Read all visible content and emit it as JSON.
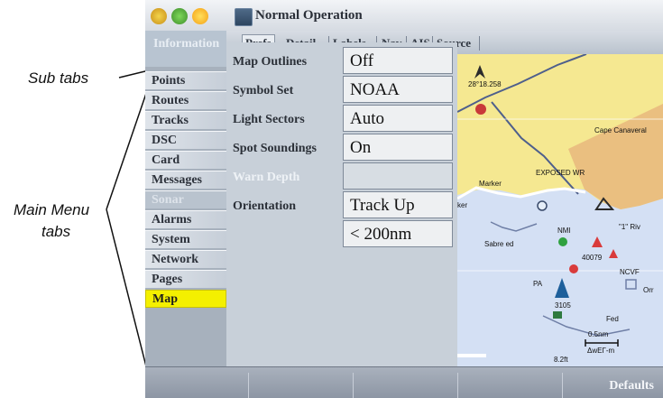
{
  "callouts": {
    "sub_tabs": "Sub tabs",
    "main_menu_tabs_line1": "Main Menu",
    "main_menu_tabs_line2": "tabs"
  },
  "window": {
    "title": "Normal Operation",
    "status_icons": [
      "battery-icon",
      "gps-icon",
      "sun-icon"
    ]
  },
  "sub_tabs": [
    {
      "label": "Prefs",
      "active": true
    },
    {
      "label": "Detail",
      "active": false
    },
    {
      "label": "Labels",
      "active": false
    },
    {
      "label": "Nav",
      "active": false
    },
    {
      "label": "AIS",
      "active": false
    },
    {
      "label": "Source",
      "active": false
    }
  ],
  "main_menu": {
    "header": "Information",
    "items": [
      {
        "label": "Points",
        "state": "normal"
      },
      {
        "label": "Routes",
        "state": "normal"
      },
      {
        "label": "Tracks",
        "state": "normal"
      },
      {
        "label": "DSC",
        "state": "normal"
      },
      {
        "label": "Card",
        "state": "normal"
      },
      {
        "label": "Messages",
        "state": "normal"
      },
      {
        "label": "Sonar",
        "state": "disabled"
      },
      {
        "label": "Alarms",
        "state": "normal"
      },
      {
        "label": "System",
        "state": "normal"
      },
      {
        "label": "Network",
        "state": "normal"
      },
      {
        "label": "Pages",
        "state": "normal"
      },
      {
        "label": "Map",
        "state": "active"
      }
    ]
  },
  "settings": [
    {
      "label": "Map Outlines",
      "value": "Off",
      "disabled": false
    },
    {
      "label": "Symbol Set",
      "value": "NOAA",
      "disabled": false
    },
    {
      "label": "Light Sectors",
      "value": "Auto",
      "disabled": false
    },
    {
      "label": "Spot Soundings",
      "value": "On",
      "disabled": false
    },
    {
      "label": "Warn Depth",
      "value": "",
      "disabled": true
    },
    {
      "label": "Orientation",
      "value": "Track Up",
      "disabled": false
    },
    {
      "label": "",
      "value": "< 200nm",
      "disabled": false
    }
  ],
  "map": {
    "labels": {
      "position": "28°18.258",
      "cape": "Cape Canaveral",
      "exposed": "EXPOSED WR",
      "marker": "Marker",
      "ker": "ker",
      "sabre": "Sabre ed",
      "nmi": "NMI",
      "a": "40079",
      "pa": "PA",
      "b": "3105",
      "ncvf": "NCVF",
      "fed": "Fed",
      "scale": "0.5nm",
      "dist": "8.2ft",
      "speed": "ΔwΕΓ-m",
      "rv": "\"1\" Riv",
      "orr": "Orr"
    },
    "colors": {
      "water": "#d4e0f4",
      "land": "#f5e891",
      "land_shaded": "#e7b77c",
      "channel": "#4e5f8c"
    }
  },
  "softkeys": {
    "defaults": "Defaults"
  }
}
